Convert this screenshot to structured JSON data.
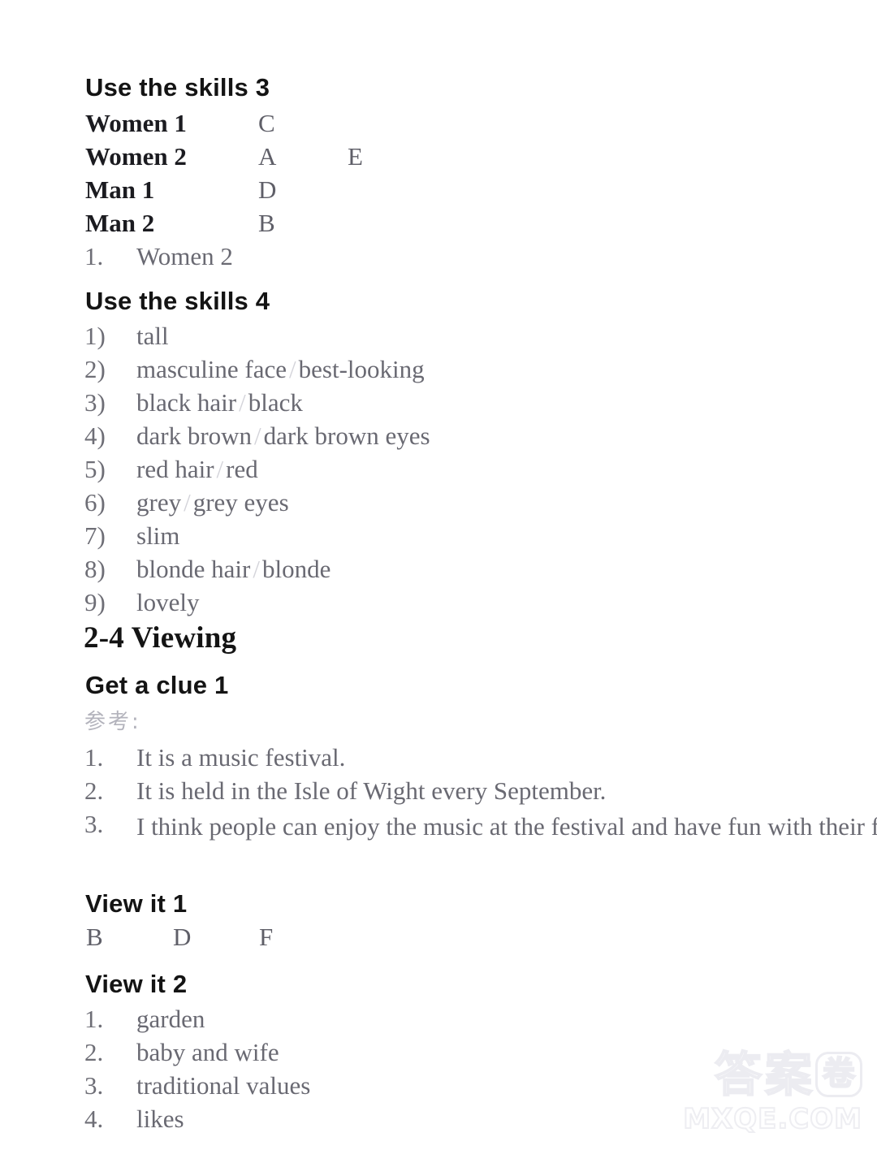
{
  "page": {
    "background_color": "#ffffff",
    "text_color_headings": "#141414",
    "text_color_body": "#55555f"
  },
  "sections": {
    "use_the_skills_3": {
      "heading": "Use the skills 3",
      "pairs": [
        {
          "label": "Women 1",
          "answer": "C",
          "answer2": ""
        },
        {
          "label": "Women 2",
          "answer": "A",
          "answer2": "E"
        },
        {
          "label": "Man 1",
          "answer": "D",
          "answer2": ""
        },
        {
          "label": "Man 2",
          "answer": "B",
          "answer2": ""
        }
      ],
      "extra_items": [
        {
          "marker": "1.",
          "text": "Women 2"
        }
      ]
    },
    "use_the_skills_4": {
      "heading": "Use the skills 4",
      "items": [
        {
          "marker": "1)",
          "text": "tall"
        },
        {
          "marker": "2)",
          "text": "masculine face / best-looking"
        },
        {
          "marker": "3)",
          "text": "black hair / black"
        },
        {
          "marker": "4)",
          "text": "dark brown / dark brown eyes"
        },
        {
          "marker": "5)",
          "text": "red hair / red"
        },
        {
          "marker": "6)",
          "text": "grey / grey eyes"
        },
        {
          "marker": "7)",
          "text": "slim"
        },
        {
          "marker": "8)",
          "text": "blonde hair / blonde"
        },
        {
          "marker": "9)",
          "text": "lovely"
        }
      ]
    },
    "unit_heading": "2-4 Viewing",
    "get_a_clue_1": {
      "heading": "Get a clue 1",
      "note": "参考:",
      "items": [
        {
          "marker": "1.",
          "text": "It is a music festival."
        },
        {
          "marker": "2.",
          "text": "It is held in the Isle of Wight every September."
        },
        {
          "marker": "3.",
          "text": "I think people can enjoy the music at the festival and have fun with their families and friends."
        }
      ]
    },
    "view_it_1": {
      "heading": "View it 1",
      "answers": [
        "B",
        "D",
        "F"
      ]
    },
    "view_it_2": {
      "heading": "View it 2",
      "items": [
        {
          "marker": "1.",
          "text": "garden"
        },
        {
          "marker": "2.",
          "text": "baby and wife"
        },
        {
          "marker": "3.",
          "text": "traditional values"
        },
        {
          "marker": "4.",
          "text": "likes"
        }
      ]
    }
  },
  "watermark": {
    "char1": "答",
    "char2": "案",
    "char3": "卷",
    "domain": "MXQE.COM"
  }
}
